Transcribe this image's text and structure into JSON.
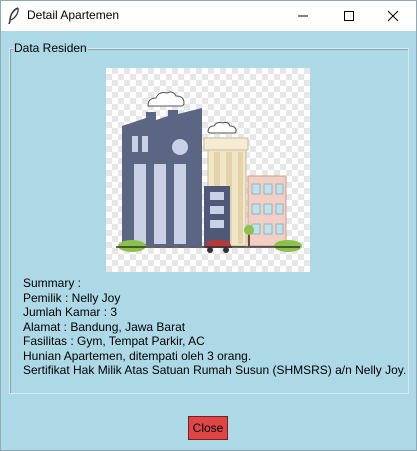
{
  "window": {
    "title": "Detail Apartemen"
  },
  "frame": {
    "label": "Data Residen"
  },
  "info": {
    "summary": "Summary :",
    "owner": "Pemilik : Nelly Joy",
    "rooms": "Jumlah Kamar : 3",
    "address": "Alamat : Bandung, Jawa Barat",
    "facilities": "Fasilitas : Gym, Tempat Parkir, AC",
    "occupancy": "Hunian Apartemen, ditempati oleh 3 orang.",
    "certificate": "Sertifikat Hak Milik Atas Satuan Rumah Susun (SHMSRS) a/n Nelly Joy."
  },
  "buttons": {
    "close_label": "Close"
  },
  "icons": {
    "app": "feather-icon",
    "minimize": "minimize-icon",
    "maximize": "maximize-icon",
    "close": "close-icon"
  },
  "colors": {
    "background": "#add8e6",
    "close_button": "#e04646"
  }
}
